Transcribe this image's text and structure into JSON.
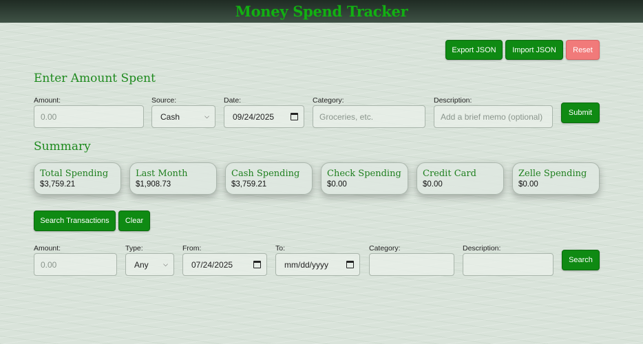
{
  "app": {
    "title": "Money Spend Tracker"
  },
  "toolbar": {
    "export_label": "Export JSON",
    "import_label": "Import JSON",
    "reset_label": "Reset"
  },
  "entry": {
    "title": "Enter Amount Spent",
    "amount_label": "Amount:",
    "amount_placeholder": "0.00",
    "source_label": "Source:",
    "source_value": "Cash",
    "date_label": "Date:",
    "date_value": "09/24/2025",
    "category_label": "Category:",
    "category_placeholder": "Groceries, etc.",
    "description_label": "Description:",
    "description_placeholder": "Add a brief memo (optional)",
    "submit_label": "Submit"
  },
  "summary": {
    "title": "Summary",
    "cards": [
      {
        "title": "Total Spending",
        "value": "$3,759.21"
      },
      {
        "title": "Last Month",
        "value": "$1,908.73"
      },
      {
        "title": "Cash Spending",
        "value": "$3,759.21"
      },
      {
        "title": "Check Spending",
        "value": "$0.00"
      },
      {
        "title": "Credit Card",
        "value": "$0.00"
      },
      {
        "title": "Zelle Spending",
        "value": "$0.00"
      }
    ]
  },
  "search": {
    "search_transactions_label": "Search Transactions",
    "clear_label": "Clear",
    "amount_label": "Amount:",
    "amount_placeholder": "0.00",
    "type_label": "Type:",
    "type_value": "Any",
    "from_label": "From:",
    "from_value": "07/24/2025",
    "to_label": "To:",
    "to_value": "mm/dd/yyyy",
    "category_label": "Category:",
    "description_label": "Description:",
    "search_label": "Search"
  },
  "colors": {
    "accent_green": "#0f8a13",
    "title_green": "#12b012",
    "reset_red": "#f17a7a"
  }
}
